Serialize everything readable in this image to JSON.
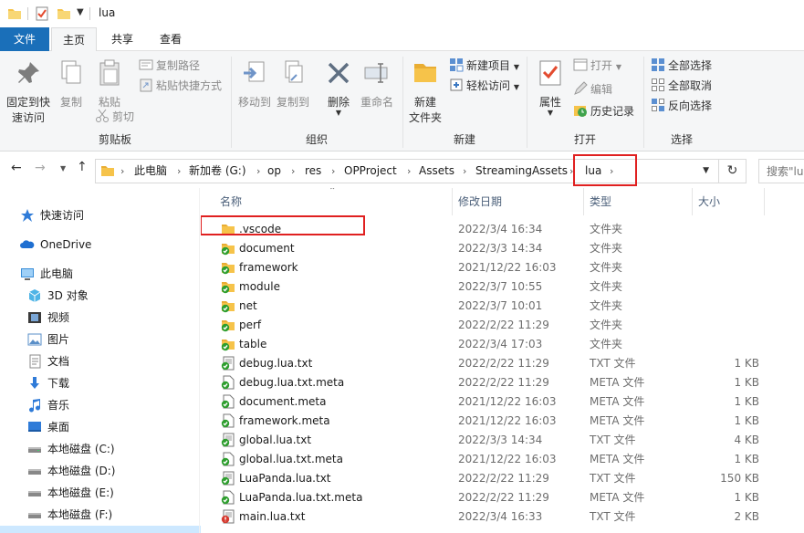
{
  "window": {
    "title": "lua"
  },
  "tabs": [
    {
      "label": "文件"
    },
    {
      "label": "主页"
    },
    {
      "label": "共享"
    },
    {
      "label": "查看"
    }
  ],
  "ribbon": {
    "clipboard": {
      "pin_label_1": "固定到快",
      "pin_label_2": "速访问",
      "copy_label": "复制",
      "paste_label": "粘贴",
      "copy_path_label": "复制路径",
      "paste_shortcut_label": "粘贴快捷方式",
      "cut_label": "剪切",
      "group_label": "剪贴板"
    },
    "organize": {
      "move_to_label": "移动到",
      "copy_to_label": "复制到",
      "delete_label": "删除",
      "rename_label": "重命名",
      "group_label": "组织"
    },
    "new": {
      "new_folder_label_1": "新建",
      "new_folder_label_2": "文件夹",
      "new_item_label": "新建项目",
      "easy_access_label": "轻松访问",
      "group_label": "新建"
    },
    "open": {
      "properties_label": "属性",
      "open_label": "打开",
      "edit_label": "编辑",
      "history_label": "历史记录",
      "group_label": "打开"
    },
    "select": {
      "select_all_label": "全部选择",
      "select_none_label": "全部取消",
      "invert_label": "反向选择",
      "group_label": "选择"
    }
  },
  "address": {
    "breadcrumbs": [
      "此电脑",
      "新加卷 (G:)",
      "op",
      "res",
      "OPProject",
      "Assets",
      "StreamingAssets",
      "lua"
    ],
    "search_placeholder": "搜索\"lua\""
  },
  "nav": {
    "quick_access": "快速访问",
    "onedrive": "OneDrive",
    "this_pc": "此电脑",
    "items": [
      "3D 对象",
      "视频",
      "图片",
      "文档",
      "下载",
      "音乐",
      "桌面",
      "本地磁盘 (C:)",
      "本地磁盘 (D:)",
      "本地磁盘 (E:)",
      "本地磁盘 (F:)"
    ]
  },
  "columns": {
    "name": "名称",
    "date": "修改日期",
    "type": "类型",
    "size": "大小"
  },
  "files": [
    {
      "name": ".vscode",
      "date": "2022/3/4 16:34",
      "type": "文件夹",
      "size": "",
      "icon": "folder-plain"
    },
    {
      "name": "document",
      "date": "2022/3/3 14:34",
      "type": "文件夹",
      "size": "",
      "icon": "folder-synced"
    },
    {
      "name": "framework",
      "date": "2021/12/22 16:03",
      "type": "文件夹",
      "size": "",
      "icon": "folder-synced"
    },
    {
      "name": "module",
      "date": "2022/3/7 10:55",
      "type": "文件夹",
      "size": "",
      "icon": "folder-synced"
    },
    {
      "name": "net",
      "date": "2022/3/7 10:01",
      "type": "文件夹",
      "size": "",
      "icon": "folder-synced"
    },
    {
      "name": "perf",
      "date": "2022/2/22 11:29",
      "type": "文件夹",
      "size": "",
      "icon": "folder-synced"
    },
    {
      "name": "table",
      "date": "2022/3/4 17:03",
      "type": "文件夹",
      "size": "",
      "icon": "folder-synced"
    },
    {
      "name": "debug.lua.txt",
      "date": "2022/2/22 11:29",
      "type": "TXT 文件",
      "size": "1 KB",
      "icon": "text-synced"
    },
    {
      "name": "debug.lua.txt.meta",
      "date": "2022/2/22 11:29",
      "type": "META 文件",
      "size": "1 KB",
      "icon": "file-synced"
    },
    {
      "name": "document.meta",
      "date": "2021/12/22 16:03",
      "type": "META 文件",
      "size": "1 KB",
      "icon": "file-synced"
    },
    {
      "name": "framework.meta",
      "date": "2021/12/22 16:03",
      "type": "META 文件",
      "size": "1 KB",
      "icon": "file-synced"
    },
    {
      "name": "global.lua.txt",
      "date": "2022/3/3 14:34",
      "type": "TXT 文件",
      "size": "4 KB",
      "icon": "text-synced"
    },
    {
      "name": "global.lua.txt.meta",
      "date": "2021/12/22 16:03",
      "type": "META 文件",
      "size": "1 KB",
      "icon": "file-synced"
    },
    {
      "name": "LuaPanda.lua.txt",
      "date": "2022/2/22 11:29",
      "type": "TXT 文件",
      "size": "150 KB",
      "icon": "text-synced"
    },
    {
      "name": "LuaPanda.lua.txt.meta",
      "date": "2022/2/22 11:29",
      "type": "META 文件",
      "size": "1 KB",
      "icon": "file-synced"
    },
    {
      "name": "main.lua.txt",
      "date": "2022/3/4 16:33",
      "type": "TXT 文件",
      "size": "2 KB",
      "icon": "text-modified"
    }
  ],
  "colors": {
    "accent": "#1a6fb9",
    "folder": "#f6c34a",
    "sync_green": "#2e9e2e",
    "highlight_red": "#e02020"
  }
}
